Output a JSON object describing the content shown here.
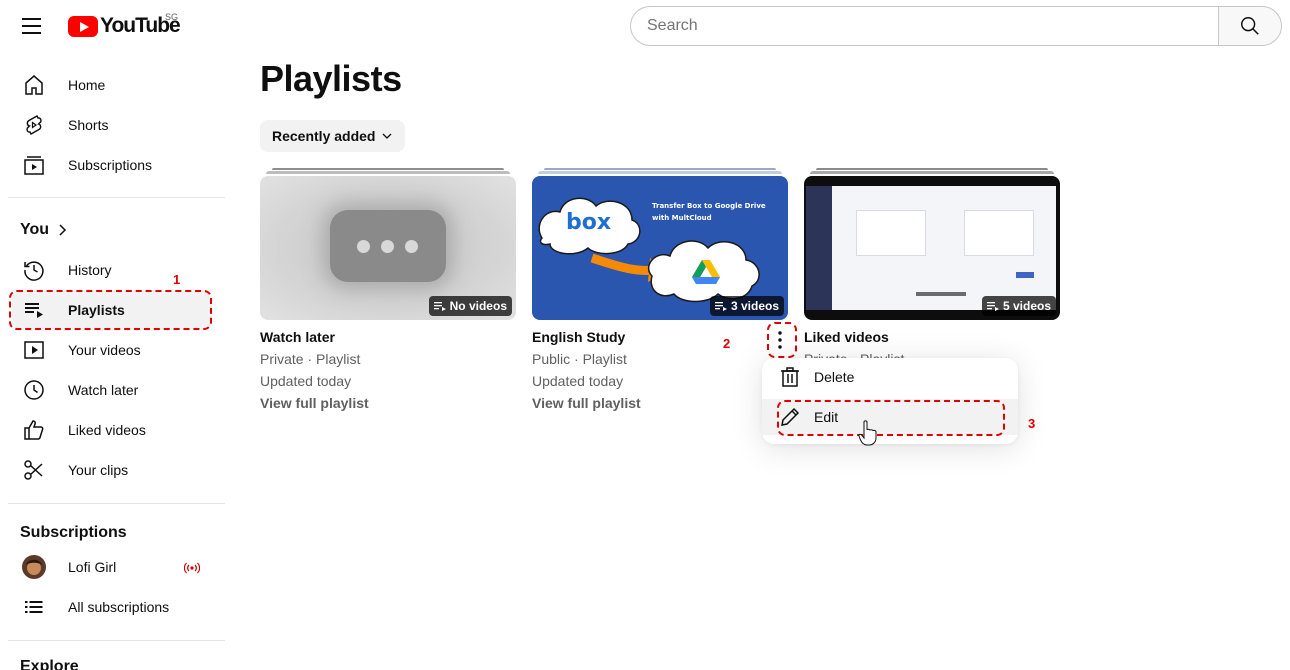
{
  "header": {
    "logo_text": "YouTube",
    "country_code": "SG",
    "search_placeholder": "Search"
  },
  "sidebar": {
    "main": [
      {
        "label": "Home",
        "icon": "home-icon"
      },
      {
        "label": "Shorts",
        "icon": "shorts-icon"
      },
      {
        "label": "Subscriptions",
        "icon": "subscriptions-icon"
      }
    ],
    "you_title": "You",
    "you_items": [
      {
        "label": "History",
        "icon": "history-icon"
      },
      {
        "label": "Playlists",
        "icon": "playlists-icon",
        "active": true
      },
      {
        "label": "Your videos",
        "icon": "your-videos-icon"
      },
      {
        "label": "Watch later",
        "icon": "watch-later-icon"
      },
      {
        "label": "Liked videos",
        "icon": "liked-videos-icon"
      },
      {
        "label": "Your clips",
        "icon": "clips-icon"
      }
    ],
    "subscriptions_title": "Subscriptions",
    "subscriptions": [
      {
        "label": "Lofi Girl",
        "live": true
      },
      {
        "label": "All subscriptions",
        "icon": "list-icon"
      }
    ],
    "explore_title": "Explore"
  },
  "main": {
    "title": "Playlists",
    "sort_label": "Recently added",
    "playlists": [
      {
        "title": "Watch later",
        "visibility": "Private · Playlist",
        "updated": "Updated today",
        "link": "View full playlist",
        "count": "No videos"
      },
      {
        "title": "English Study",
        "visibility": "Public · Playlist",
        "updated": "Updated today",
        "link": "View full playlist",
        "count": "3 videos",
        "thumb_text": "Transfer Box to Google Drive with MultCloud",
        "thumb_logo": "box"
      },
      {
        "title": "Liked videos",
        "visibility": "Private · Playlist",
        "count": "5 videos"
      }
    ]
  },
  "context_menu": {
    "items": [
      {
        "label": "Delete",
        "icon": "trash-icon"
      },
      {
        "label": "Edit",
        "icon": "pencil-icon"
      }
    ]
  },
  "annotations": [
    "1",
    "2",
    "3"
  ],
  "colors": {
    "brand": "#ff0000",
    "annotation": "#e00000",
    "thumb_blue": "#2b56b0"
  }
}
